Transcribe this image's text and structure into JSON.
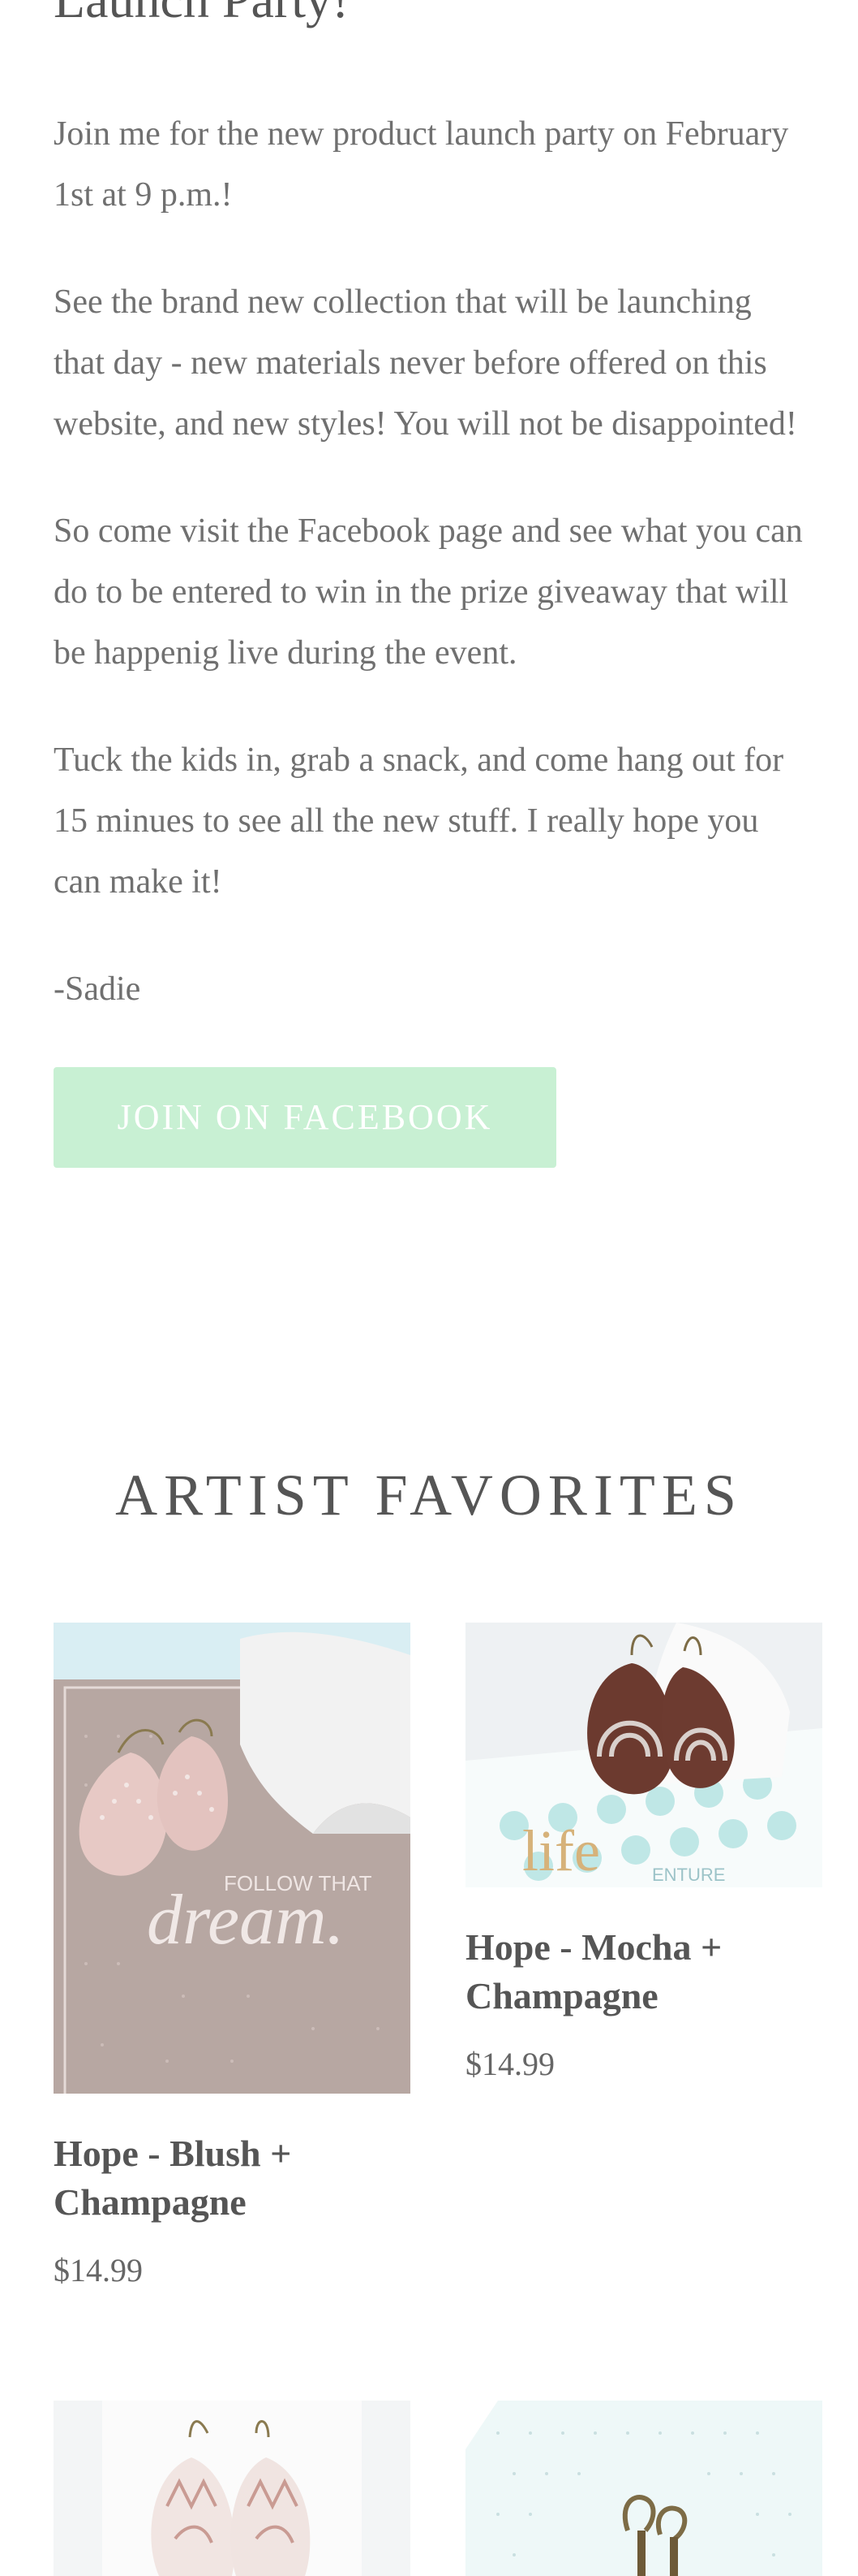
{
  "post": {
    "title": "Launch Party!",
    "paragraphs": [
      "Join me for the new product launch party on February 1st at 9 p.m.!",
      "See the brand new collection that will be launching that day - new materials never before offered on this website, and new styles! You will not be disappointed!",
      "So come visit the Facebook page and see what you can do to be entered to win in the prize giveaway that will be happenig live during the event.",
      "Tuck the kids in, grab a snack, and come hang out for 15 minues to see all the new stuff. I really hope you can make it!"
    ],
    "signature": "-Sadie",
    "button_label": "JOIN ON FACEBOOK"
  },
  "favorites": {
    "heading": "ARTIST FAVORITES",
    "products": [
      {
        "title": "Hope - Blush + Champagne",
        "price": "$14.99",
        "image_text_line1": "FOLLOW THAT",
        "image_text_line2": "dream."
      },
      {
        "title": "Hope - Mocha + Champagne",
        "price": "$14.99",
        "image_text_line1": "life",
        "image_text_line2": "ENTURE"
      }
    ]
  },
  "colors": {
    "button_bg": "#c8f0d3",
    "text": "#707070",
    "heading": "#555555"
  }
}
